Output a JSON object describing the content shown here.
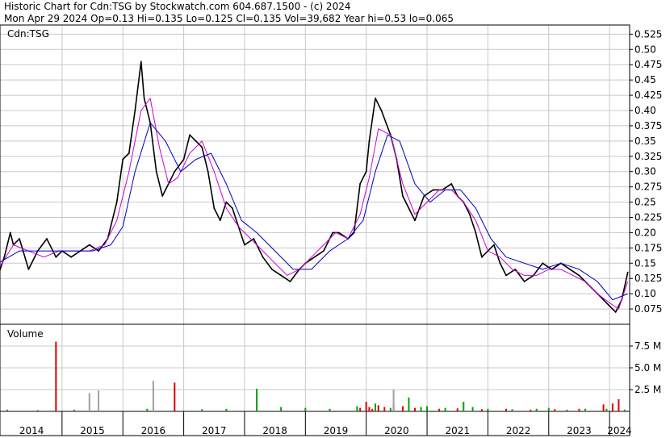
{
  "header": {
    "line1": "Historic Chart for Cdn:TSG by Stockwatch.com 604.687.1500 - (c) 2024",
    "line2": "Mon Apr 29 2024  Op=0.13  Hi=0.135  Lo=0.125  Cl=0.135  Vol=39,682  Year hi=0.53  lo=0.065"
  },
  "chart_data": [
    {
      "type": "line",
      "title": "Cdn:TSG",
      "xlabel": "",
      "ylabel": "",
      "ylim": [
        0.05,
        0.54
      ],
      "yticks": [
        "0.075",
        "0.10",
        "0.125",
        "0.15",
        "0.175",
        "0.20",
        "0.225",
        "0.25",
        "0.275",
        "0.30",
        "0.325",
        "0.35",
        "0.375",
        "0.40",
        "0.425",
        "0.45",
        "0.475",
        "0.50",
        "0.525"
      ],
      "x_labels": [
        "2014",
        "2015",
        "2016",
        "2017",
        "2018",
        "2019",
        "2020",
        "2021",
        "2022",
        "2023",
        "2024"
      ],
      "grid": true,
      "series": [
        {
          "color": "#000000",
          "x": [
            2013.95,
            2014.05,
            2014.15,
            2014.2,
            2014.3,
            2014.45,
            2014.6,
            2014.75,
            2014.9,
            2015.0,
            2015.15,
            2015.3,
            2015.45,
            2015.6,
            2015.75,
            2015.9,
            2016.0,
            2016.1,
            2016.2,
            2016.3,
            2016.35,
            2016.45,
            2016.55,
            2016.65,
            2016.75,
            2016.85,
            2017.0,
            2017.1,
            2017.2,
            2017.3,
            2017.4,
            2017.5,
            2017.6,
            2017.7,
            2017.8,
            2017.9,
            2018.0,
            2018.15,
            2018.3,
            2018.45,
            2018.6,
            2018.75,
            2018.9,
            2019.0,
            2019.15,
            2019.3,
            2019.45,
            2019.55,
            2019.7,
            2019.8,
            2019.9,
            2020.0,
            2020.05,
            2020.15,
            2020.25,
            2020.4,
            2020.5,
            2020.6,
            2020.7,
            2020.8,
            2020.95,
            2021.1,
            2021.25,
            2021.4,
            2021.5,
            2021.6,
            2021.7,
            2021.8,
            2021.9,
            2022.0,
            2022.1,
            2022.2,
            2022.3,
            2022.45,
            2022.6,
            2022.75,
            2022.9,
            2023.05,
            2023.2,
            2023.35,
            2023.5,
            2023.6,
            2023.7,
            2023.8,
            2023.9,
            2024.0,
            2024.1,
            2024.2,
            2024.3
          ],
          "y": [
            0.13,
            0.16,
            0.2,
            0.18,
            0.19,
            0.14,
            0.17,
            0.19,
            0.16,
            0.17,
            0.16,
            0.17,
            0.18,
            0.17,
            0.19,
            0.25,
            0.32,
            0.33,
            0.4,
            0.48,
            0.42,
            0.38,
            0.3,
            0.26,
            0.28,
            0.3,
            0.32,
            0.36,
            0.35,
            0.34,
            0.3,
            0.24,
            0.22,
            0.25,
            0.24,
            0.21,
            0.18,
            0.19,
            0.16,
            0.14,
            0.13,
            0.12,
            0.14,
            0.15,
            0.16,
            0.17,
            0.2,
            0.2,
            0.19,
            0.2,
            0.28,
            0.3,
            0.35,
            0.42,
            0.4,
            0.36,
            0.32,
            0.26,
            0.24,
            0.22,
            0.26,
            0.27,
            0.27,
            0.28,
            0.26,
            0.25,
            0.23,
            0.2,
            0.16,
            0.17,
            0.18,
            0.15,
            0.13,
            0.14,
            0.12,
            0.13,
            0.15,
            0.14,
            0.15,
            0.14,
            0.13,
            0.12,
            0.11,
            0.1,
            0.09,
            0.08,
            0.07,
            0.09,
            0.135
          ]
        },
        {
          "color": "#d000d0",
          "x": [
            2013.95,
            2014.2,
            2014.45,
            2014.7,
            2014.95,
            2015.2,
            2015.45,
            2015.7,
            2015.9,
            2016.1,
            2016.3,
            2016.45,
            2016.6,
            2016.75,
            2016.9,
            2017.1,
            2017.3,
            2017.5,
            2017.7,
            2017.9,
            2018.1,
            2018.3,
            2018.5,
            2018.7,
            2018.9,
            2019.1,
            2019.3,
            2019.5,
            2019.7,
            2019.9,
            2020.05,
            2020.2,
            2020.4,
            2020.6,
            2020.8,
            2021.0,
            2021.2,
            2021.4,
            2021.6,
            2021.8,
            2022.0,
            2022.2,
            2022.4,
            2022.6,
            2022.8,
            2023.0,
            2023.2,
            2023.4,
            2023.6,
            2023.8,
            2024.0,
            2024.15,
            2024.3
          ],
          "y": [
            0.14,
            0.18,
            0.17,
            0.16,
            0.17,
            0.17,
            0.17,
            0.18,
            0.22,
            0.3,
            0.4,
            0.42,
            0.34,
            0.28,
            0.29,
            0.33,
            0.35,
            0.3,
            0.24,
            0.21,
            0.19,
            0.17,
            0.15,
            0.13,
            0.14,
            0.16,
            0.18,
            0.2,
            0.19,
            0.23,
            0.29,
            0.37,
            0.36,
            0.28,
            0.23,
            0.25,
            0.27,
            0.27,
            0.25,
            0.22,
            0.17,
            0.16,
            0.14,
            0.13,
            0.13,
            0.14,
            0.14,
            0.13,
            0.12,
            0.1,
            0.085,
            0.075,
            0.12
          ]
        },
        {
          "color": "#0000c0",
          "x": [
            2013.95,
            2014.3,
            2014.7,
            2015.1,
            2015.5,
            2015.8,
            2016.0,
            2016.2,
            2016.45,
            2016.7,
            2016.95,
            2017.2,
            2017.45,
            2017.7,
            2017.95,
            2018.2,
            2018.5,
            2018.8,
            2019.1,
            2019.4,
            2019.7,
            2019.95,
            2020.15,
            2020.35,
            2020.55,
            2020.8,
            2021.05,
            2021.3,
            2021.55,
            2021.8,
            2022.05,
            2022.3,
            2022.6,
            2022.9,
            2023.2,
            2023.5,
            2023.8,
            2024.05,
            2024.3
          ],
          "y": [
            0.15,
            0.17,
            0.17,
            0.17,
            0.17,
            0.18,
            0.21,
            0.3,
            0.38,
            0.35,
            0.3,
            0.32,
            0.33,
            0.28,
            0.22,
            0.2,
            0.17,
            0.14,
            0.14,
            0.17,
            0.19,
            0.22,
            0.3,
            0.36,
            0.35,
            0.28,
            0.25,
            0.27,
            0.27,
            0.24,
            0.19,
            0.16,
            0.15,
            0.14,
            0.15,
            0.14,
            0.12,
            0.09,
            0.1
          ]
        }
      ]
    },
    {
      "type": "bar",
      "title": "Volume",
      "xlabel": "",
      "ylabel": "",
      "ylim": [
        0,
        10
      ],
      "yticks": [
        "2.5 M",
        "5.0 M",
        "7.5 M"
      ],
      "grid": true,
      "series": [
        {
          "name": "",
          "color": "#dd0000",
          "x": [
            2014.9,
            2016.85,
            2019.9,
            2020.0,
            2020.05,
            2020.1,
            2020.2,
            2020.3,
            2020.45,
            2020.6,
            2020.8,
            2021.2,
            2021.5,
            2021.9,
            2022.3,
            2022.7,
            2023.1,
            2023.5,
            2023.9,
            2024.05,
            2024.15
          ],
          "values": [
            8.0,
            3.3,
            0.4,
            1.1,
            0.5,
            0.3,
            0.7,
            0.5,
            0.9,
            0.6,
            0.4,
            0.3,
            0.35,
            0.25,
            0.3,
            0.2,
            0.25,
            0.3,
            0.8,
            0.9,
            1.4
          ]
        },
        {
          "name": "",
          "color": "#00a000",
          "x": [
            2014.1,
            2014.6,
            2015.2,
            2016.4,
            2017.3,
            2017.7,
            2018.2,
            2018.6,
            2019.0,
            2019.4,
            2019.85,
            2020.15,
            2020.4,
            2020.7,
            2020.9,
            2021.0,
            2021.3,
            2021.6,
            2021.75,
            2022.0,
            2022.4,
            2022.8,
            2023.0,
            2023.3,
            2023.6,
            2023.95,
            2024.25
          ],
          "values": [
            0.2,
            0.15,
            0.2,
            0.3,
            0.25,
            0.3,
            2.6,
            0.5,
            0.4,
            0.3,
            0.6,
            0.9,
            0.4,
            1.6,
            0.5,
            0.6,
            0.4,
            1.1,
            0.5,
            0.3,
            0.25,
            0.3,
            0.4,
            0.2,
            0.3,
            0.3,
            0.2
          ]
        },
        {
          "name": "",
          "color": "#a0a0a0",
          "x": [
            2015.45,
            2015.6,
            2016.5,
            2020.45
          ],
          "values": [
            2.1,
            2.4,
            3.5,
            2.5
          ]
        }
      ]
    }
  ]
}
